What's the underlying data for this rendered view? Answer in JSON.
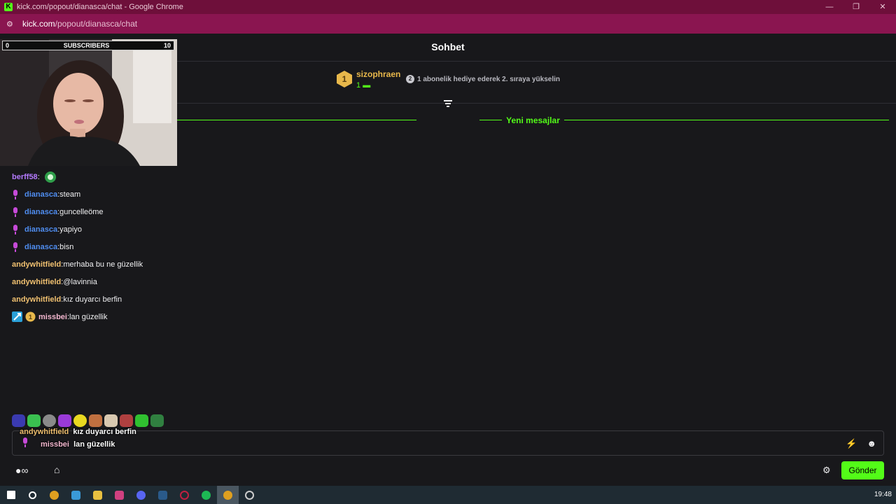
{
  "browser": {
    "window_title": "kick.com/popout/dianasca/chat - Google Chrome",
    "url_domain": "kick.com",
    "url_path": "/popout/dianasca/chat"
  },
  "chat": {
    "title": "Sohbet",
    "pinned": {
      "rank": "1",
      "user": "sizophraen",
      "count": "1",
      "rank2": "2",
      "note": "1 abonelik hediye ederek 2. sıraya yükselin"
    },
    "new_messages": "Yeni mesajlar",
    "messages": [
      {
        "user": "berff58",
        "sep": ":",
        "text": "",
        "color": "#b57bff",
        "mic": false
      },
      {
        "user": "dianasca",
        "sep": ":",
        "text": " steam",
        "color": "#4f8df0",
        "mic": true
      },
      {
        "user": "dianasca",
        "sep": ":",
        "text": " guncelleöme",
        "color": "#4f8df0",
        "mic": true
      },
      {
        "user": "dianasca",
        "sep": ":",
        "text": " yapiyo",
        "color": "#4f8df0",
        "mic": true
      },
      {
        "user": "dianasca",
        "sep": ":",
        "text": " bisn",
        "color": "#4f8df0",
        "mic": true
      },
      {
        "user": "andywhitfield",
        "sep": ":",
        "text": " merhaba bu ne güzellik",
        "color": "#f0c070",
        "mic": false
      },
      {
        "user": "andywhitfield",
        "sep": ":",
        "text": " @lavinnia",
        "color": "#f0c070",
        "mic": false
      },
      {
        "user": "andywhitfield",
        "sep": ":",
        "text": " kız duyarcı berfin",
        "color": "#f0c070",
        "mic": false
      },
      {
        "user": "missbei",
        "sep": ":",
        "text": " lan güzellik",
        "color": "#f5b8d0",
        "mic": false,
        "badge_rank": "1"
      }
    ],
    "overlay": [
      {
        "user": "andywhitfield",
        "text": "kız duyarcı berfin",
        "color": "#f0c070"
      },
      {
        "user": "missbei",
        "text": "lan güzellik",
        "color": "#f5b8d0"
      }
    ],
    "send_label": "Gönder"
  },
  "webcam": {
    "sub_left": "0",
    "sub_label": "SUBSCRIBERS",
    "sub_right": "10"
  },
  "taskbar": {
    "clock": "19:48"
  }
}
